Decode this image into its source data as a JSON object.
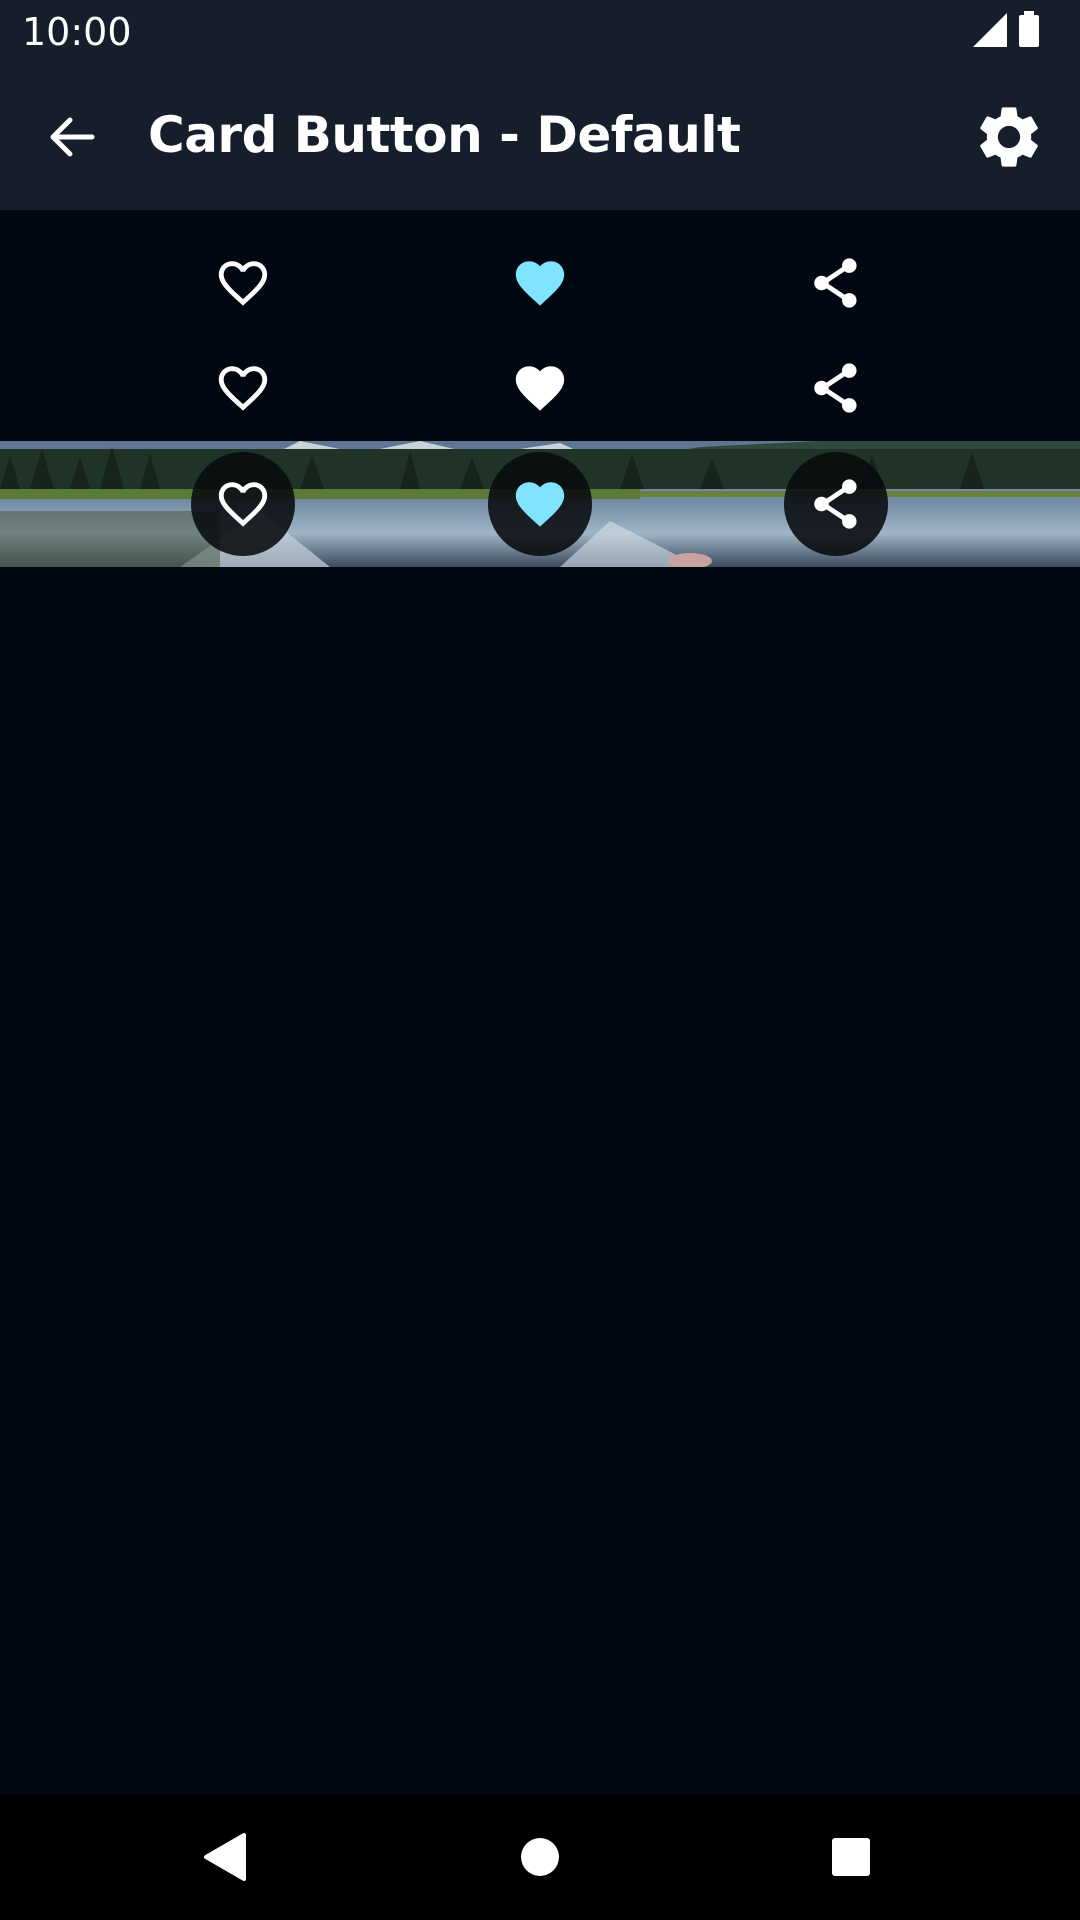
{
  "status_bar": {
    "time": "10:00"
  },
  "app_bar": {
    "title": "Card Button - Default"
  },
  "colors": {
    "accent": "#81e4ff",
    "background": "#020812",
    "surface": "#161d2b",
    "icon": "#ffffff"
  },
  "card_buttons": {
    "row_1": [
      "heart-outline-icon",
      "heart-filled-accent-icon",
      "share-icon"
    ],
    "row_2": [
      "heart-outline-icon",
      "heart-filled-white-icon",
      "share-icon"
    ],
    "row_3_on_image": [
      "heart-outline-icon",
      "heart-filled-accent-icon",
      "share-icon"
    ]
  },
  "nav_bar": {
    "icons": [
      "back-triangle-icon",
      "home-circle-icon",
      "recents-square-icon"
    ]
  }
}
